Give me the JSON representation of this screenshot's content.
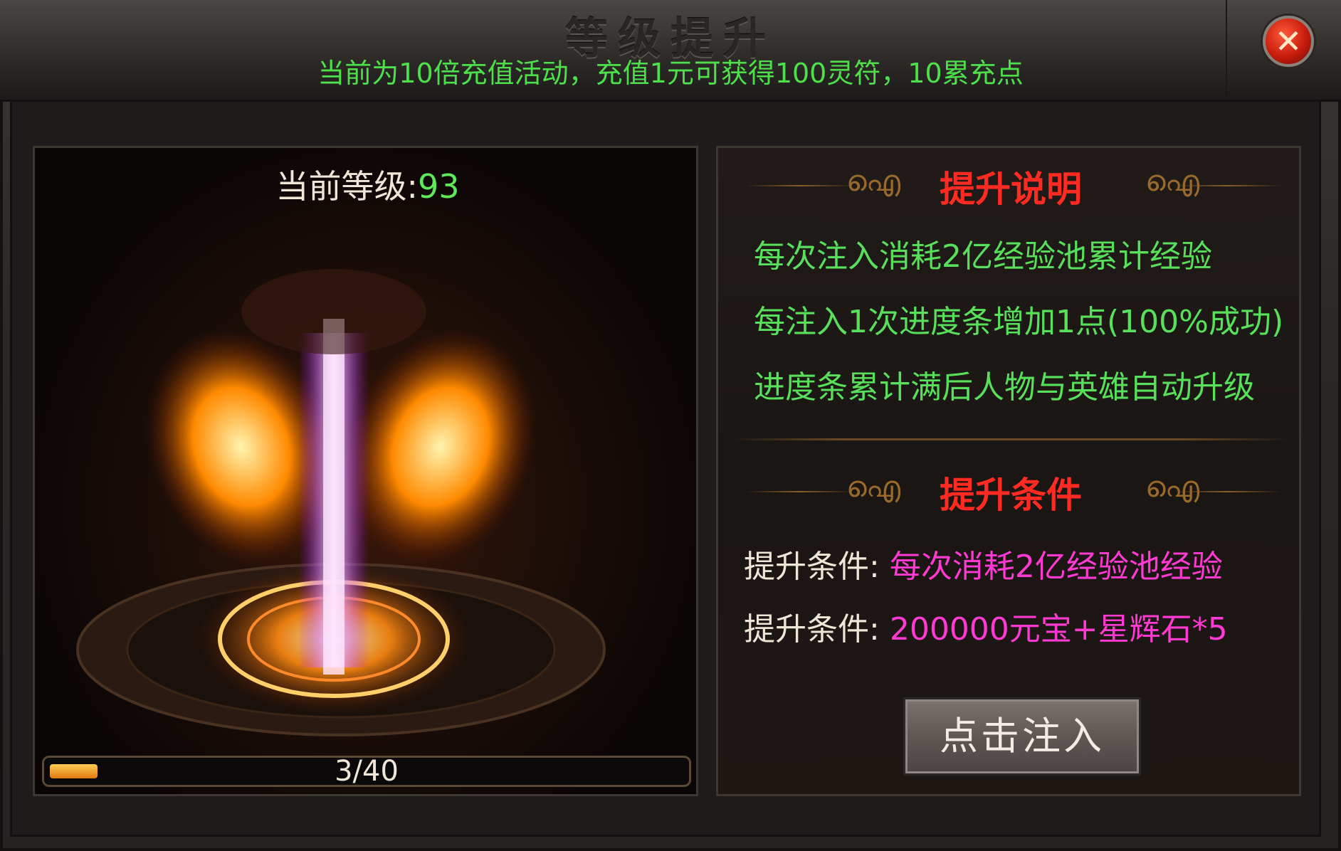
{
  "window": {
    "title": "等级提升",
    "notice": "当前为10倍充值活动，充值1元可获得100灵符，10累充点",
    "close_icon": "close-icon"
  },
  "left": {
    "level_label": "当前等级:",
    "level_value": "93",
    "progress": {
      "text": "3/40",
      "current": 3,
      "max": 40
    }
  },
  "right": {
    "desc_title": "提升说明",
    "desc_lines": [
      "每次注入消耗2亿经验池累计经验",
      "每注入1次进度条增加1点(100%成功)",
      "进度条累计满后人物与英雄自动升级"
    ],
    "cond_title": "提升条件",
    "conditions": [
      {
        "label": "提升条件:",
        "value": "每次消耗2亿经验池经验"
      },
      {
        "label": "提升条件:",
        "value": "200000元宝+星辉石*5"
      }
    ],
    "inject_button": "点击注入"
  },
  "colors": {
    "notice": "#4ee04a",
    "level_value": "#5ee85a",
    "section_title": "#ff2a22",
    "desc_text": "#58e05a",
    "cond_value": "#ff3ad2"
  }
}
